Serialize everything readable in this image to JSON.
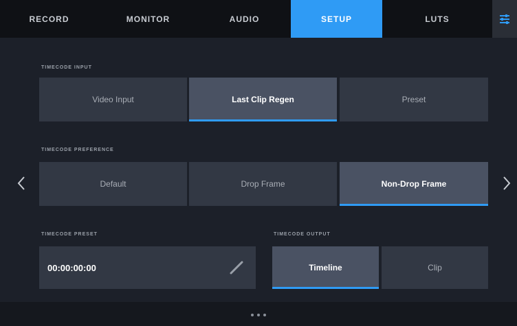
{
  "tabs": [
    {
      "label": "RECORD"
    },
    {
      "label": "MONITOR"
    },
    {
      "label": "AUDIO"
    },
    {
      "label": "SETUP",
      "active": true
    },
    {
      "label": "LUTS"
    }
  ],
  "timecode_input": {
    "label": "TIMECODE INPUT",
    "options": [
      "Video Input",
      "Last Clip Regen",
      "Preset"
    ],
    "selected": "Last Clip Regen"
  },
  "timecode_preference": {
    "label": "TIMECODE PREFERENCE",
    "options": [
      "Default",
      "Drop Frame",
      "Non-Drop Frame"
    ],
    "selected": "Non-Drop Frame"
  },
  "timecode_preset": {
    "label": "TIMECODE PRESET",
    "value": "00:00:00:00"
  },
  "timecode_output": {
    "label": "TIMECODE OUTPUT",
    "options": [
      "Timeline",
      "Clip"
    ],
    "selected": "Timeline"
  },
  "colors": {
    "accent": "#2f9bf5",
    "background": "#1c2029",
    "button": "#323844",
    "button_selected": "#4a5263"
  },
  "icons": [
    "settings-sliders-icon",
    "chevron-left-icon",
    "chevron-right-icon",
    "pencil-icon",
    "page-dots-icon"
  ]
}
